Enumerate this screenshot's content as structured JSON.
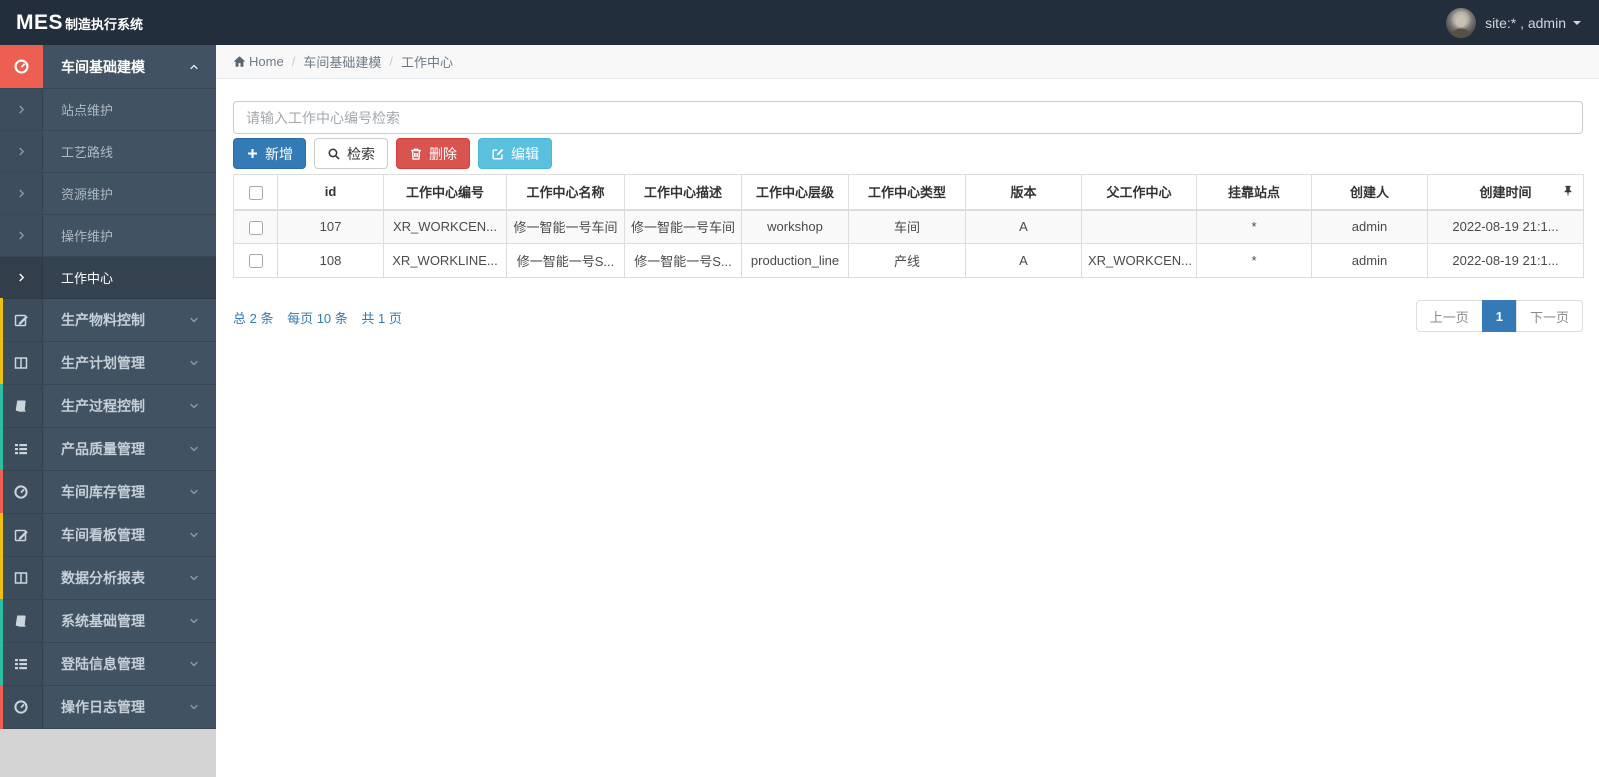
{
  "navbar": {
    "logo_mes": "MES",
    "logo_suffix": "制造执行系统",
    "user_label": "site:* , admin"
  },
  "breadcrumb": {
    "home": "Home",
    "separator": "/",
    "level1": "车间基础建模",
    "level2": "工作中心"
  },
  "sidebar": {
    "active_group": {
      "label": "车间基础建模",
      "icon": "dashboard-icon"
    },
    "submenu": [
      {
        "label": "站点维护"
      },
      {
        "label": "工艺路线"
      },
      {
        "label": "资源维护"
      },
      {
        "label": "操作维护"
      },
      {
        "label": "工作中心"
      }
    ],
    "items": [
      {
        "label": "生产物料控制",
        "icon": "edit-icon",
        "accent": "#eec111"
      },
      {
        "label": "生产计划管理",
        "icon": "columns-icon",
        "accent": "#eec111"
      },
      {
        "label": "生产过程控制",
        "icon": "book-icon",
        "accent": "#2cbfa4"
      },
      {
        "label": "产品质量管理",
        "icon": "list-icon",
        "accent": "#2cbfa4"
      },
      {
        "label": "车间库存管理",
        "icon": "dashboard-icon",
        "accent": "#ed5f51"
      },
      {
        "label": "车间看板管理",
        "icon": "edit-icon",
        "accent": "#eec111"
      },
      {
        "label": "数据分析报表",
        "icon": "columns-icon",
        "accent": "#eec111"
      },
      {
        "label": "系统基础管理",
        "icon": "book-icon",
        "accent": "#2cbfa4"
      },
      {
        "label": "登陆信息管理",
        "icon": "list-icon",
        "accent": "#2cbfa4"
      },
      {
        "label": "操作日志管理",
        "icon": "dashboard-icon",
        "accent": "#ed5f51"
      }
    ]
  },
  "search": {
    "placeholder": "请输入工作中心编号检索",
    "value": ""
  },
  "toolbar": {
    "add_label": "新增",
    "search_label": "检索",
    "delete_label": "删除",
    "edit_label": "编辑"
  },
  "table": {
    "headers": [
      "id",
      "工作中心编号",
      "工作中心名称",
      "工作中心描述",
      "工作中心层级",
      "工作中心类型",
      "版本",
      "父工作中心",
      "挂靠站点",
      "创建人",
      "创建时间"
    ],
    "rows": [
      [
        "107",
        "XR_WORKCEN...",
        "修一智能一号车间",
        "修一智能一号车间",
        "workshop",
        "车间",
        "A",
        "",
        "*",
        "admin",
        "2022-08-19 21:1..."
      ],
      [
        "108",
        "XR_WORKLINE...",
        "修一智能一号S...",
        "修一智能一号S...",
        "production_line",
        "产线",
        "A",
        "XR_WORKCEN...",
        "*",
        "admin",
        "2022-08-19 21:1..."
      ]
    ]
  },
  "pagination": {
    "summary_total": "总 2 条",
    "summary_per_page": "每页 10 条",
    "summary_pages": "共 1 页",
    "prev_label": "上一页",
    "current_page": "1",
    "next_label": "下一页"
  },
  "colors": {
    "navbar_bg": "#222e3c",
    "sidebar_bg": "#415262",
    "active_accent": "#ed5f51",
    "accent_yellow": "#eec111",
    "accent_teal": "#2cbfa4",
    "accent_red": "#ed5f51",
    "primary_blue": "#337ab7",
    "danger_red": "#d9534f",
    "info_blue": "#5bc0de",
    "stripe_gray": "#f9f9f9"
  }
}
